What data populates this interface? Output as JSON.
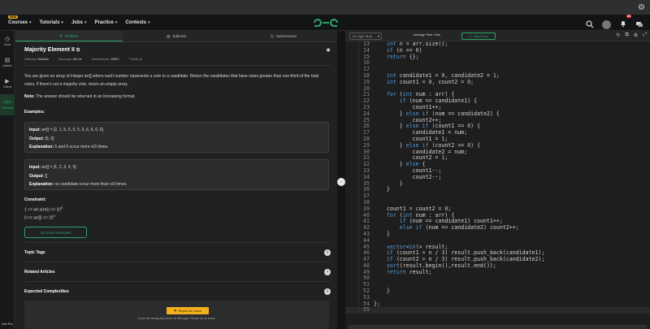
{
  "nav": {
    "courses_badge": "NEW",
    "items": [
      "Courses",
      "Tutorials",
      "Jobs",
      "Practice",
      "Contests"
    ],
    "logo": "geeksforgeeks-logo",
    "notif_count": "83"
  },
  "rail": {
    "items": [
      {
        "icon": "clock-icon",
        "glyph": "◷",
        "label": "Clock"
      },
      {
        "icon": "article-icon",
        "glyph": "▤",
        "label": "Articles"
      },
      {
        "icon": "video-icon",
        "glyph": "▶",
        "label": "Videos"
      },
      {
        "icon": "code-icon",
        "glyph": "</>",
        "label": "Problems"
      }
    ],
    "bottom": "Get Pro"
  },
  "tabs": [
    "Problem",
    "Editorial",
    "Submissions"
  ],
  "problem": {
    "title": "Majority Element II",
    "meta": {
      "difficulty_label": "Difficulty:",
      "difficulty": "Medium",
      "accuracy_label": "Accuracy:",
      "accuracy": "48.1%",
      "submissions_label": "Submissions:",
      "submissions": "199K+",
      "points_label": "Points:",
      "points": "4"
    },
    "desc_1": "You are given an array of integer arr[] where each number represents a vote to a candidate. Return the candidates that have votes greater than one-third of the total votes, If there's not a majority vote, return an empty array.",
    "note_label": "Note:",
    "note": " The answer should be returned in an increasing format.",
    "examples_heading": "Examples:",
    "ex1": {
      "input": "arr[] = [2, 1, 5, 5, 5, 5, 6, 6, 6, 6, 6]",
      "output": "[5, 6]",
      "explanation": "5 and 6 occur more n/3 times."
    },
    "ex2": {
      "input": "arr[] = [1, 2, 3, 4, 5]",
      "output": "[]",
      "explanation": "no candidate occur more than n/3 times."
    },
    "input_label": "Input:",
    "output_label": "Output:",
    "explanation_label": "Explanation:",
    "constraint_heading": "Constraint:",
    "constraint_1": "1 <= arr.size() <= 10",
    "constraint_1_exp": "6",
    "constraint_2": "0 <= arr[i] <= 10",
    "constraint_2_exp": "9",
    "try_more": "Try more examples",
    "accordions": [
      "Topic Tags",
      "Related Articles",
      "Expected Complexities"
    ],
    "report_button": "Report An Issue",
    "report_text": "If you are facing any issue on this page. Please let us know."
  },
  "editor": {
    "language": "C++ (g++ 5.4)",
    "avg_time": "Average Time: 15m",
    "start_timer": "Start Timer",
    "lines": [
      {
        "n": "13",
        "t": "    int n = arr.size();"
      },
      {
        "n": "14",
        "t": "    if (n == 0)"
      },
      {
        "n": "15",
        "t": "    return {};"
      },
      {
        "n": "16",
        "t": ""
      },
      {
        "n": "17",
        "t": ""
      },
      {
        "n": "18",
        "t": "    int candidate1 = 0, candidate2 = 1;"
      },
      {
        "n": "19",
        "t": "    int count1 = 0, count2 = 0;"
      },
      {
        "n": "20",
        "t": ""
      },
      {
        "n": "21",
        "t": "    for (int num : arr) {"
      },
      {
        "n": "22",
        "t": "        if (num == candidate1) {"
      },
      {
        "n": "23",
        "t": "            count1++;"
      },
      {
        "n": "24",
        "t": "        } else if (num == candidate2) {"
      },
      {
        "n": "25",
        "t": "            count2++;"
      },
      {
        "n": "26",
        "t": "        } else if (count1 == 0) {"
      },
      {
        "n": "27",
        "t": "            candidate1 = num;"
      },
      {
        "n": "28",
        "t": "            count1 = 1;"
      },
      {
        "n": "29",
        "t": "        } else if (count2 == 0) {"
      },
      {
        "n": "30",
        "t": "            candidate2 = num;"
      },
      {
        "n": "31",
        "t": "            count2 = 1;"
      },
      {
        "n": "32",
        "t": "        } else {"
      },
      {
        "n": "33",
        "t": "            count1--;"
      },
      {
        "n": "34",
        "t": "            count2--;"
      },
      {
        "n": "35",
        "t": "        }"
      },
      {
        "n": "36",
        "t": "    }"
      },
      {
        "n": "37",
        "t": ""
      },
      {
        "n": "38",
        "t": ""
      },
      {
        "n": "39",
        "t": "    count1 = count2 = 0;"
      },
      {
        "n": "40",
        "t": "    for (int num : arr) {"
      },
      {
        "n": "41",
        "t": "        if (num == candidate1) count1++;"
      },
      {
        "n": "42",
        "t": "        else if (num == candidate2) count2++;"
      },
      {
        "n": "43",
        "t": "    }"
      },
      {
        "n": "44",
        "t": ""
      },
      {
        "n": "45",
        "t": "    vector<int> result;"
      },
      {
        "n": "46",
        "t": "    if (count1 > n / 3) result.push_back(candidate1);"
      },
      {
        "n": "47",
        "t": "    if (count2 > n / 3) result.push_back(candidate2);"
      },
      {
        "n": "48",
        "t": "    sort(result.begin(),result.end());"
      },
      {
        "n": "49",
        "t": "    return result;"
      },
      {
        "n": "50",
        "t": ""
      },
      {
        "n": "51",
        "t": ""
      },
      {
        "n": "52",
        "t": "    }"
      },
      {
        "n": "53",
        "t": ""
      },
      {
        "n": "54",
        "t": "};"
      },
      {
        "n": "55",
        "t": ""
      }
    ]
  }
}
